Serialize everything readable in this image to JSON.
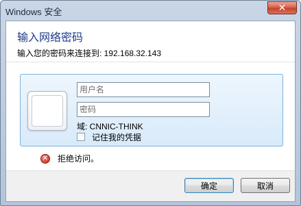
{
  "window": {
    "title": "Windows 安全",
    "close_glyph": "✕"
  },
  "header": {
    "title": "输入网络密码",
    "subtitle": "输入您的密码来连接到: 192.168.32.143"
  },
  "credentials": {
    "username_placeholder": "用户名",
    "password_placeholder": "密码",
    "domain": "域: CNNIC-THINK",
    "remember_label": "记住我的凭据",
    "remember_checked": false
  },
  "error": {
    "icon": "error-icon",
    "icon_glyph": "✕",
    "message": "拒绝访问。"
  },
  "buttons": {
    "ok_label": "确定",
    "cancel_label": "取消"
  },
  "colors": {
    "accent_title": "#1e3a8a",
    "close_button": "#c8412a",
    "tile_border": "#7fb0dd"
  }
}
